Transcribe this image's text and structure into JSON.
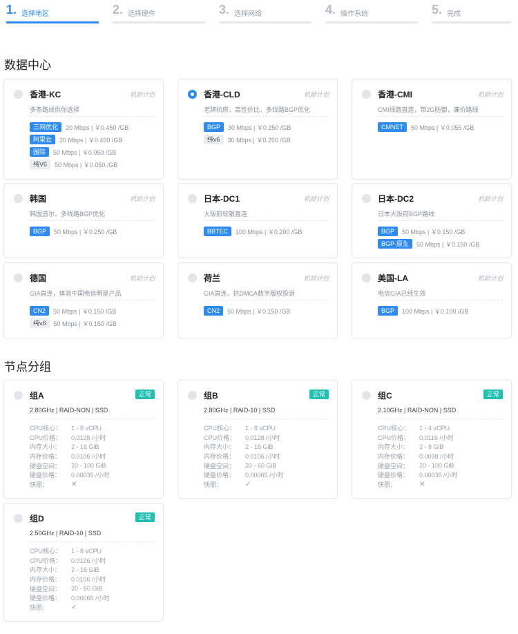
{
  "steps": [
    {
      "num": "1.",
      "label": "选择地区"
    },
    {
      "num": "2.",
      "label": "选择硬件"
    },
    {
      "num": "3.",
      "label": "选择网络"
    },
    {
      "num": "4.",
      "label": "操作系统"
    },
    {
      "num": "5.",
      "label": "完成"
    }
  ],
  "datacenter_title": "数据中心",
  "node_group_title": "节点分组",
  "datacenters": [
    {
      "name": "香港-KC",
      "plan": "机龄计划",
      "desc": "多条路线供你选择",
      "lines": [
        {
          "tag": "三网优化",
          "price": "20 Mbps | ￥0.450 /GB"
        },
        {
          "tag": "阿里云",
          "price": "20 Mbps | ￥0.450 /GB"
        },
        {
          "tag": "国际",
          "price": "50 Mbps | ￥0.050 /GB"
        },
        {
          "tag": "纯V6",
          "price": "50 Mbps | ￥0.050 /GB"
        }
      ]
    },
    {
      "name": "香港-CLD",
      "plan": "机龄计划",
      "desc": "老牌机房，高性价比，多线路BGP优化",
      "lines": [
        {
          "tag": "BGP",
          "price": "30 Mbps | ￥0.250 /GB"
        },
        {
          "tag": "纯v6",
          "price": "30 Mbps | ￥0.250 /GB"
        }
      ]
    },
    {
      "name": "香港-CMI",
      "plan": "机龄计划",
      "desc": "CMI线路直连，带2G防御，廉价路线",
      "lines": [
        {
          "tag": "CMNET",
          "price": "50 Mbps | ￥0.055 /GB"
        }
      ]
    },
    {
      "name": "韩国",
      "plan": "机龄计划",
      "desc": "韩国首尔，多线路BGP优化",
      "lines": [
        {
          "tag": "BGP",
          "price": "50 Mbps | ￥0.250 /GB"
        }
      ]
    },
    {
      "name": "日本-DC1",
      "plan": "机龄计划",
      "desc": "大阪府软银直连",
      "lines": [
        {
          "tag": "BBTEC",
          "price": "100 Mbps | ￥0.200 /GB"
        }
      ]
    },
    {
      "name": "日本-DC2",
      "plan": "机龄计划",
      "desc": "日本大阪府BGP路线",
      "lines": [
        {
          "tag": "BGP",
          "price": "50 Mbps | ￥0.150 /GB"
        },
        {
          "tag": "BGP-原生",
          "price": "50 Mbps | ￥0.150 /GB"
        }
      ]
    },
    {
      "name": "德国",
      "plan": "机龄计划",
      "desc": "GIA直连，体验中国电信明星产品",
      "lines": [
        {
          "tag": "CN2",
          "price": "50 Mbps | ￥0.150 /GB"
        },
        {
          "tag": "纯v6",
          "price": "50 Mbps | ￥0.150 /GB"
        }
      ]
    },
    {
      "name": "荷兰",
      "plan": "机龄计划",
      "desc": "GIA直连，抗DMCA数字版权投诉",
      "lines": [
        {
          "tag": "CN2",
          "price": "50 Mbps | ￥0.150 /GB"
        }
      ]
    },
    {
      "name": "美国-LA",
      "plan": "机龄计划",
      "desc": "电信GIA已经生效",
      "lines": [
        {
          "tag": "BGP",
          "price": "100 Mbps | ￥0.100 /GB"
        }
      ]
    }
  ],
  "groups": [
    {
      "name": "组A",
      "status": "正常",
      "sub": "2.80GHz | RAID-NON | SSD",
      "cpu_cores": "1 - 8 vCPU",
      "cpu_price": "0.0128 /小时",
      "mem_size": "2 - 16 GiB",
      "mem_price": "0.0106 /小时",
      "disk_size": "20 - 100 GiB",
      "disk_price": "0.00035 /小时",
      "snapshot": "✕"
    },
    {
      "name": "组B",
      "status": "正常",
      "sub": "2.80GHz | RAID-10 | SSD",
      "cpu_cores": "1 - 8 vCPU",
      "cpu_price": "0.0128 /小时",
      "mem_size": "2 - 16 GiB",
      "mem_price": "0.0106 /小时",
      "disk_size": "20 - 60 GiB",
      "disk_price": "0.00065 /小时",
      "snapshot": "✓"
    },
    {
      "name": "组C",
      "status": "正常",
      "sub": "2.10GHz | RAID-NON | SSD",
      "cpu_cores": "1 - 4 vCPU",
      "cpu_price": "0.0116 /小时",
      "mem_size": "2 - 8 GiB",
      "mem_price": "0.0098 /小时",
      "disk_size": "20 - 100 GiB",
      "disk_price": "0.00035 /小时",
      "snapshot": "✕"
    },
    {
      "name": "组D",
      "status": "正常",
      "sub": "2.50GHz | RAID-10 | SSD",
      "cpu_cores": "1 - 8 vCPU",
      "cpu_price": "0.0126 /小时",
      "mem_size": "2 - 16 GiB",
      "mem_price": "0.0106 /小时",
      "disk_size": "20 - 60 GiB",
      "disk_price": "0.00065 /小时",
      "snapshot": "✓"
    }
  ],
  "spec_labels": {
    "cpu_cores": "CPU核心：",
    "cpu_price": "CPU价格：",
    "mem_size": "内存大小：",
    "mem_price": "内存价格：",
    "disk_size": "硬盘空间：",
    "disk_price": "硬盘价格：",
    "snapshot": "快照："
  },
  "colors": {
    "accent": "#2e8bf5",
    "status_ok": "#1ec1b2",
    "tag_grey": "#eceef2"
  }
}
